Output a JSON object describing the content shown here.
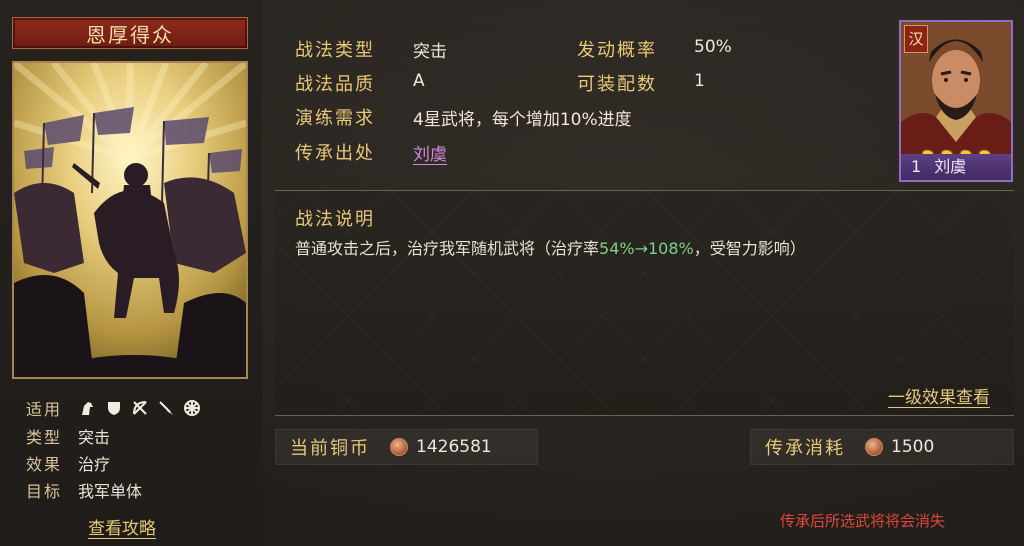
{
  "skill": {
    "name": "恩厚得众",
    "applicable_label": "适用",
    "applicable_icons": [
      "cavalry-icon",
      "shield-icon",
      "bow-icon",
      "spear-icon",
      "wheel-icon"
    ],
    "meta": [
      {
        "label": "类型",
        "value": "突击"
      },
      {
        "label": "效果",
        "value": "治疗"
      },
      {
        "label": "目标",
        "value": "我军单体"
      }
    ],
    "strategy_link": "查看攻略"
  },
  "attributes": {
    "type_label": "战法类型",
    "type_value": "突击",
    "rate_label": "发动概率",
    "rate_value": "50%",
    "quality_label": "战法品质",
    "quality_value": "A",
    "slots_label": "可装配数",
    "slots_value": "1",
    "training_label": "演练需求",
    "training_value": "4星武将，每个增加10%进度",
    "origin_label": "传承出处",
    "origin_value": "刘虞"
  },
  "general": {
    "faction": "汉",
    "level": "1",
    "name": "刘虞",
    "stars": 4
  },
  "description": {
    "title": "战法说明",
    "text_before": "普通攻击之后，治疗我军随机武将（治疗率",
    "text_highlight": "54%→108%",
    "text_after": "，受智力影响）",
    "level_link": "一级效果查看"
  },
  "resources": {
    "coins_label": "当前铜币",
    "coins_value": "1426581",
    "cost_label": "传承消耗",
    "cost_value": "1500"
  },
  "warning": "传承后所选武将将会消失",
  "colors": {
    "gold": "#e9c879",
    "banner_red": "#7a2217",
    "highlight_green": "#7dd08c",
    "link_purple": "#d488e0",
    "warning_red": "#e0463c"
  }
}
